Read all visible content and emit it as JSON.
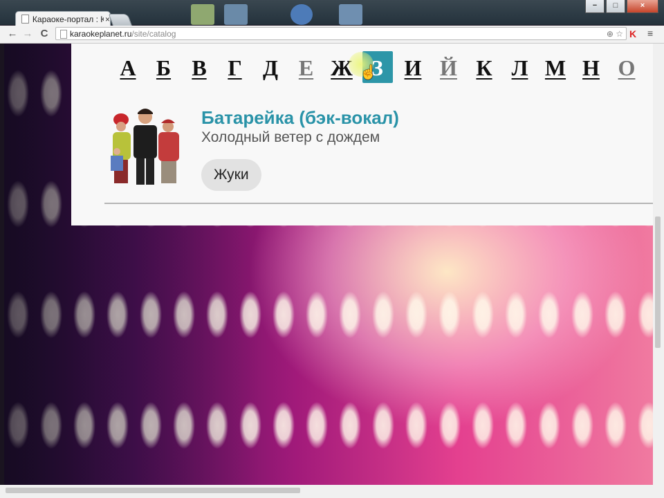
{
  "browser": {
    "tab_title": "Караоке-портал : Ка",
    "tab_close": "×",
    "url_host": "karaokeplanet.ru",
    "url_path": "/site/catalog",
    "back": "←",
    "forward": "→",
    "reload": "C",
    "zoom_icon": "⊕",
    "star_icon": "☆",
    "extension_label": "K",
    "menu_icon": "≡",
    "minimize": "−",
    "maximize": "□",
    "close": "×"
  },
  "alphabet": {
    "letters": [
      "А",
      "Б",
      "В",
      "Г",
      "Д",
      "Е",
      "Ж",
      "З",
      "И",
      "Й",
      "К",
      "Л",
      "М",
      "Н",
      "О"
    ],
    "active": "З",
    "dimmed": [
      "Е",
      "Й",
      "О"
    ]
  },
  "song": {
    "title": "Батарейка (бэк-вокал)",
    "subtitle": "Холодный ветер с дождем",
    "artist": "Жуки"
  },
  "colors": {
    "accent": "#2d96a8",
    "artist_chip": "#e2e2e2"
  }
}
